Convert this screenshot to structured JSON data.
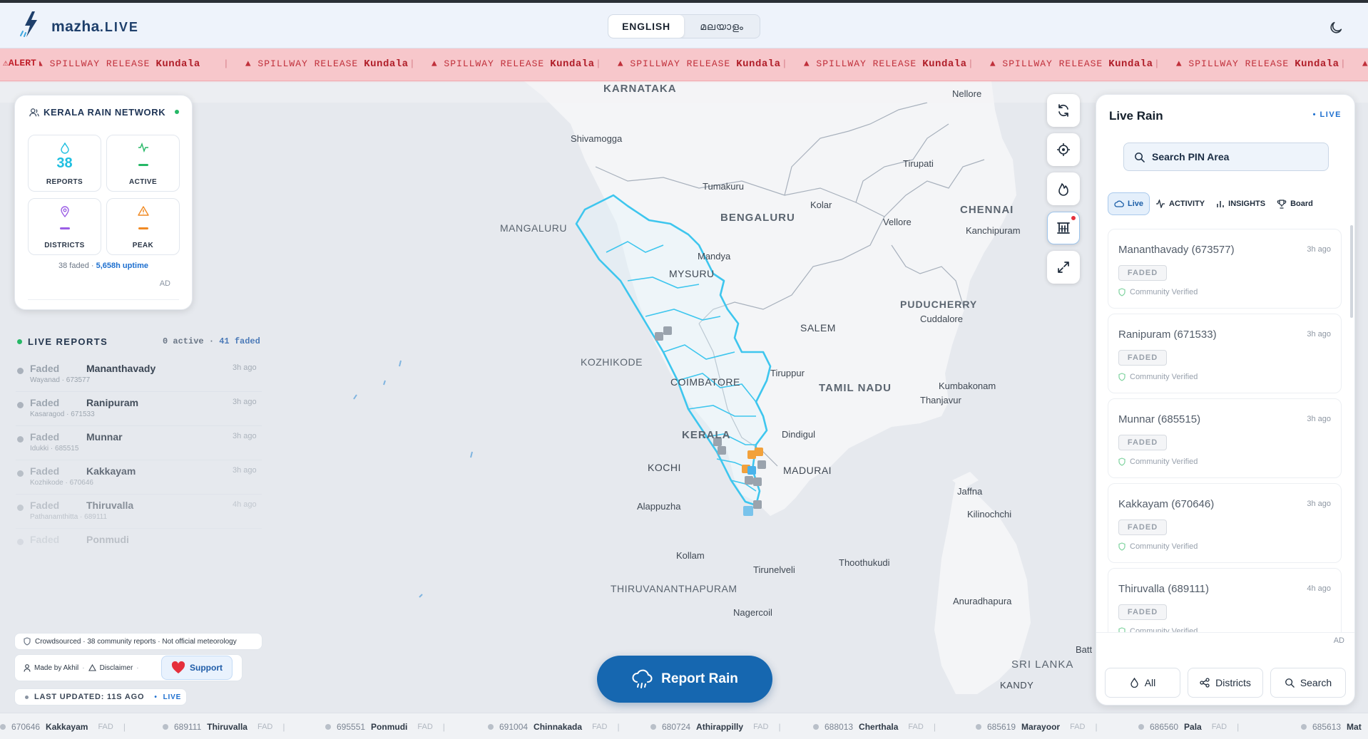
{
  "header": {
    "brand_main": "mazha",
    "brand_suffix": ".LIVE",
    "lang_options": [
      "ENGLISH",
      "മലയാളം"
    ]
  },
  "alert": {
    "badge": "⚠ALERT",
    "items": [
      {
        "type": "▲ SPILLWAY RELEASE",
        "place": "Kundala"
      },
      {
        "type": "▲ SPILLWAY RELEASE",
        "place": "Kundala"
      },
      {
        "type": "▲ SPILLWAY RELEASE",
        "place": "Kundala"
      },
      {
        "type": "▲ SPILLWAY RELEASE",
        "place": "Kundala"
      },
      {
        "type": "▲ SPILLWAY RELEASE",
        "place": "Kundala"
      },
      {
        "type": "▲ SPILLWAY RELEASE",
        "place": "Kundala"
      },
      {
        "type": "▲ SPILLWAY RELEASE",
        "place": "Kundala"
      },
      {
        "type": "▲ SPILLWAY RELEASE",
        "place": "Kundala"
      }
    ]
  },
  "network": {
    "title": "KERALA RAIN NETWORK",
    "reports_value": "38",
    "reports_label": "REPORTS",
    "active_label": "ACTIVE",
    "districts_label": "DISTRICTS",
    "peak_label": "PEAK",
    "faded": "38 faded",
    "dot_sep": "·",
    "uptime": "5,658h uptime",
    "ad": "AD"
  },
  "live_reports": {
    "title": "LIVE REPORTS",
    "active": "0 active",
    "faded": "41 faded",
    "dot_sep": "·",
    "rows": [
      {
        "status": "Faded",
        "name": "Mananthavady",
        "sub": "Wayanad · 673577",
        "time": "3h ago"
      },
      {
        "status": "Faded",
        "name": "Ranipuram",
        "sub": "Kasaragod · 671533",
        "time": "3h ago"
      },
      {
        "status": "Faded",
        "name": "Munnar",
        "sub": "Idukki · 685515",
        "time": "3h ago"
      },
      {
        "status": "Faded",
        "name": "Kakkayam",
        "sub": "Kozhikode · 670646",
        "time": "3h ago"
      },
      {
        "status": "Faded",
        "name": "Thiruvalla",
        "sub": "Pathanamthitta · 689111",
        "time": "4h ago"
      },
      {
        "status": "Faded",
        "name": "Ponmudi",
        "sub": "",
        "time": ""
      }
    ]
  },
  "footer_info": {
    "crowdsourced": "Crowdsourced · 38 community reports · Not official meteorology",
    "made_by": "Made by Akhil",
    "disclaimer": "Disclaimer",
    "dot_sep": "·",
    "support": "Support",
    "last_updated": "LAST UPDATED: 11S AGO",
    "live": "LIVE"
  },
  "report_button": "Report Rain",
  "map_labels": {
    "karnataka": "KARNATAKA",
    "nellore": "Nellore",
    "shivamogga": "Shivamogga",
    "tirupati": "Tirupati",
    "tumakuru": "Tumakuru",
    "kolar": "Kolar",
    "chennai": "CHENNAI",
    "bengaluru": "BENGALURU",
    "vellore": "Vellore",
    "kanchipuram": "Kanchipuram",
    "mangaluru": "MANGALURU",
    "mandya": "Mandya",
    "mysuru": "MYSURU",
    "puducherry": "PUDUCHERRY",
    "cuddalore": "Cuddalore",
    "salem": "SALEM",
    "kozhikode": "KOZHIKODE",
    "tiruppur": "Tiruppur",
    "coimbatore": "COIMBATORE",
    "tamilnadu": "TAMIL NADU",
    "kumbakonam": "Kumbakonam",
    "thanjavur": "Thanjavur",
    "kerala": "KERALA",
    "dindigul": "Dindigul",
    "kochi": "KOCHI",
    "madurai": "MADURAI",
    "jaffna": "Jaffna",
    "alappuzha": "Alappuzha",
    "kilinochchi": "Kilinochchi",
    "kollam": "Kollam",
    "tirunelveli": "Tirunelveli",
    "thoothukudi": "Thoothukudi",
    "thiruvananthapuram": "THIRUVANANTHAPURAM",
    "anuradhapura": "Anuradhapura",
    "nagercoil": "Nagercoil",
    "batti": "Batt",
    "srilanka": "SRI LANKA",
    "kandy": "KANDY"
  },
  "panel": {
    "title": "Live Rain",
    "live": "LIVE",
    "search_placeholder": "Search PIN Area",
    "tabs": [
      "Live",
      "ACTIVITY",
      "INSIGHTS",
      "Board"
    ],
    "rows": [
      {
        "name": "Mananthavady (673577)",
        "time": "3h ago",
        "badge": "FADED",
        "verified": "Community Verified"
      },
      {
        "name": "Ranipuram (671533)",
        "time": "3h ago",
        "badge": "FADED",
        "verified": "Community Verified"
      },
      {
        "name": "Munnar (685515)",
        "time": "3h ago",
        "badge": "FADED",
        "verified": "Community Verified"
      },
      {
        "name": "Kakkayam (670646)",
        "time": "3h ago",
        "badge": "FADED",
        "verified": "Community Verified"
      },
      {
        "name": "Thiruvalla (689111)",
        "time": "4h ago",
        "badge": "FADED",
        "verified": "Community Verified"
      }
    ],
    "ad": "AD",
    "buttons": [
      "All",
      "Districts",
      "Search"
    ]
  },
  "bottom_ticker": {
    "first_fad": "FAD",
    "items": [
      {
        "pin": "670646",
        "name": "Kakkayam",
        "fad": "FAD"
      },
      {
        "pin": "689111",
        "name": "Thiruvalla",
        "fad": "FAD"
      },
      {
        "pin": "695551",
        "name": "Ponmudi",
        "fad": "FAD"
      },
      {
        "pin": "691004",
        "name": "Chinnakada",
        "fad": "FAD"
      },
      {
        "pin": "680724",
        "name": "Athirappilly",
        "fad": "FAD"
      },
      {
        "pin": "688013",
        "name": "Cherthala",
        "fad": "FAD"
      },
      {
        "pin": "685619",
        "name": "Marayoor",
        "fad": "FAD"
      },
      {
        "pin": "686560",
        "name": "Pala",
        "fad": "FAD"
      },
      {
        "pin": "685613",
        "name": "Mat",
        "fad": ""
      }
    ]
  },
  "colors": {
    "accent": "#1667b0",
    "alert_bg": "#f7c7cb",
    "alert_text": "#c0303b",
    "kerala_border": "#3ec6ee",
    "live_green": "#26b866"
  }
}
